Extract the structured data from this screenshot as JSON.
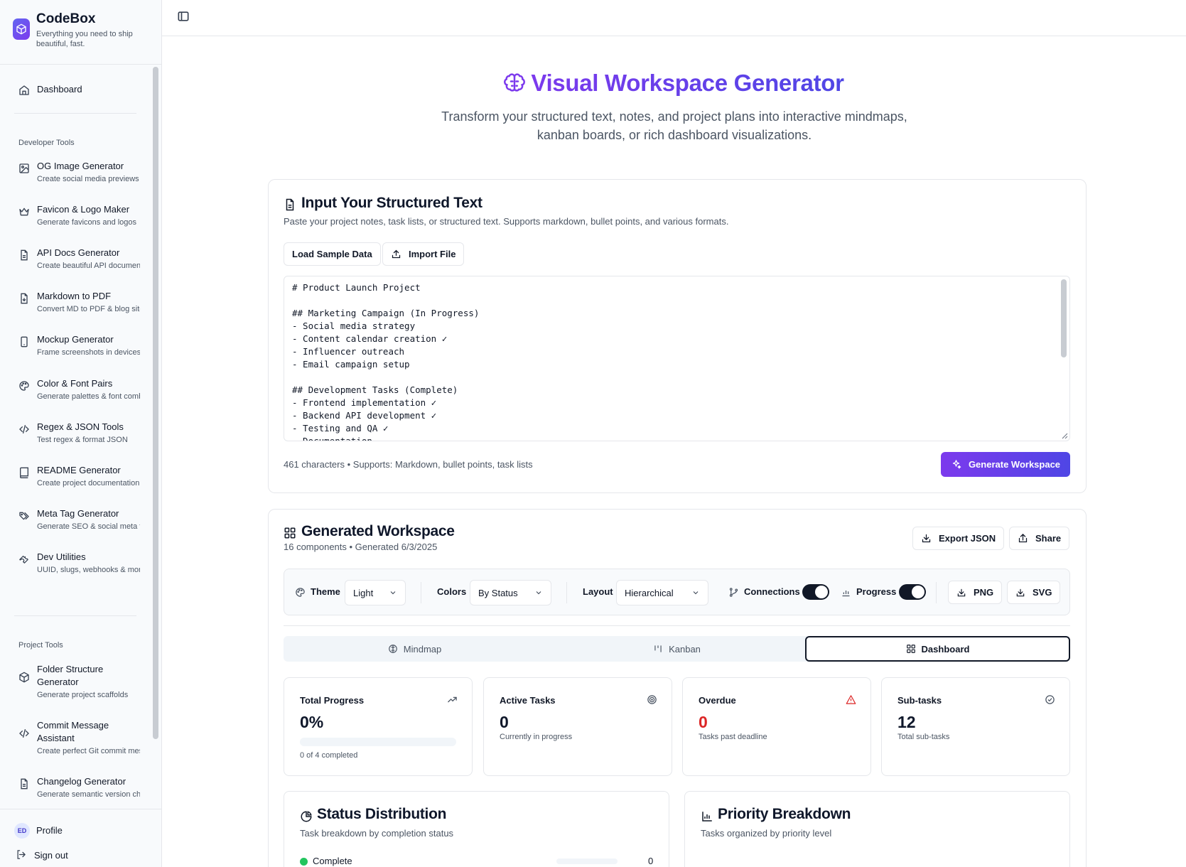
{
  "brand": {
    "name": "CodeBox",
    "tagline": "Everything you need to ship beautiful, fast."
  },
  "sidebar": {
    "dashboard": "Dashboard",
    "developer_label": "Developer Tools",
    "developer_tools": [
      {
        "title": "OG Image Generator",
        "desc": "Create social media previews",
        "icon": "image-icon"
      },
      {
        "title": "Favicon & Logo Maker",
        "desc": "Generate favicons and logos",
        "icon": "crown-icon"
      },
      {
        "title": "API Docs Generator",
        "desc": "Create beautiful API documentation",
        "icon": "document-icon"
      },
      {
        "title": "Markdown to PDF",
        "desc": "Convert MD to PDF & blog sites",
        "icon": "file-download-icon"
      },
      {
        "title": "Mockup Generator",
        "desc": "Frame screenshots in devices",
        "icon": "phone-icon"
      },
      {
        "title": "Color & Font Pairs",
        "desc": "Generate palettes & font combos",
        "icon": "palette-icon"
      },
      {
        "title": "Regex & JSON Tools",
        "desc": "Test regex & format JSON",
        "icon": "code-icon"
      },
      {
        "title": "README Generator",
        "desc": "Create project documentation",
        "icon": "book-icon"
      },
      {
        "title": "Meta Tag Generator",
        "desc": "Generate SEO & social meta tags",
        "icon": "tags-icon"
      },
      {
        "title": "Dev Utilities",
        "desc": "UUID, slugs, webhooks & more",
        "icon": "wrench-icon"
      }
    ],
    "project_label": "Project Tools",
    "project_tools": [
      {
        "title": "Folder Structure Generator",
        "desc": "Generate project scaffolds",
        "icon": "package-icon"
      },
      {
        "title": "Commit Message Assistant",
        "desc": "Create perfect Git commit messages",
        "icon": "code-icon"
      },
      {
        "title": "Changelog Generator",
        "desc": "Generate semantic version changelogs",
        "icon": "document-icon"
      }
    ],
    "avatar_initials": "ED",
    "profile": "Profile",
    "sign_out": "Sign out"
  },
  "hero": {
    "title": "Visual Workspace Generator",
    "subtitle": "Transform your structured text, notes, and project plans into interactive mindmaps, kanban boards, or rich dashboard visualizations."
  },
  "input_card": {
    "title": "Input Your Structured Text",
    "desc": "Paste your project notes, task lists, or structured text. Supports markdown, bullet points, and various formats.",
    "load_sample": "Load Sample Data",
    "import_file": "Import File",
    "text": "# Product Launch Project\n\n## Marketing Campaign (In Progress)\n- Social media strategy\n- Content calendar creation ✓\n- Influencer outreach\n- Email campaign setup\n\n## Development Tasks (Complete)\n- Frontend implementation ✓\n- Backend API development ✓\n- Testing and QA ✓\n- Documentation",
    "footer": "461 characters • Supports: Markdown, bullet points, task lists",
    "generate": "Generate Workspace"
  },
  "workspace": {
    "title": "Generated Workspace",
    "meta": "16 components • Generated 6/3/2025",
    "export_json": "Export JSON",
    "share": "Share",
    "theme_label": "Theme",
    "theme_value": "Light",
    "colors_label": "Colors",
    "colors_value": "By Status",
    "layout_label": "Layout",
    "layout_value": "Hierarchical",
    "connections_label": "Connections",
    "progress_label": "Progress",
    "png": "PNG",
    "svg": "SVG",
    "tabs": [
      "Mindmap",
      "Kanban",
      "Dashboard"
    ],
    "stats": [
      {
        "label": "Total Progress",
        "value": "0%",
        "sub": "0 of 4 completed",
        "progress": 0,
        "icon": "trending-up-icon"
      },
      {
        "label": "Active Tasks",
        "value": "0",
        "sub": "Currently in progress",
        "icon": "target-icon"
      },
      {
        "label": "Overdue",
        "value": "0",
        "sub": "Tasks past deadline",
        "icon": "alert-triangle-icon"
      },
      {
        "label": "Sub-tasks",
        "value": "12",
        "sub": "Total sub-tasks",
        "icon": "check-circle-icon"
      }
    ],
    "status_title": "Status Distribution",
    "status_desc": "Task breakdown by completion status",
    "status_row_label": "Complete",
    "status_row_value": "0",
    "priority_title": "Priority Breakdown",
    "priority_desc": "Tasks organized by priority level"
  },
  "colors": {
    "accent_start": "#7c3aed",
    "accent_end": "#4f46e5",
    "overdue": "#dc2626",
    "complete": "#22c55e"
  }
}
